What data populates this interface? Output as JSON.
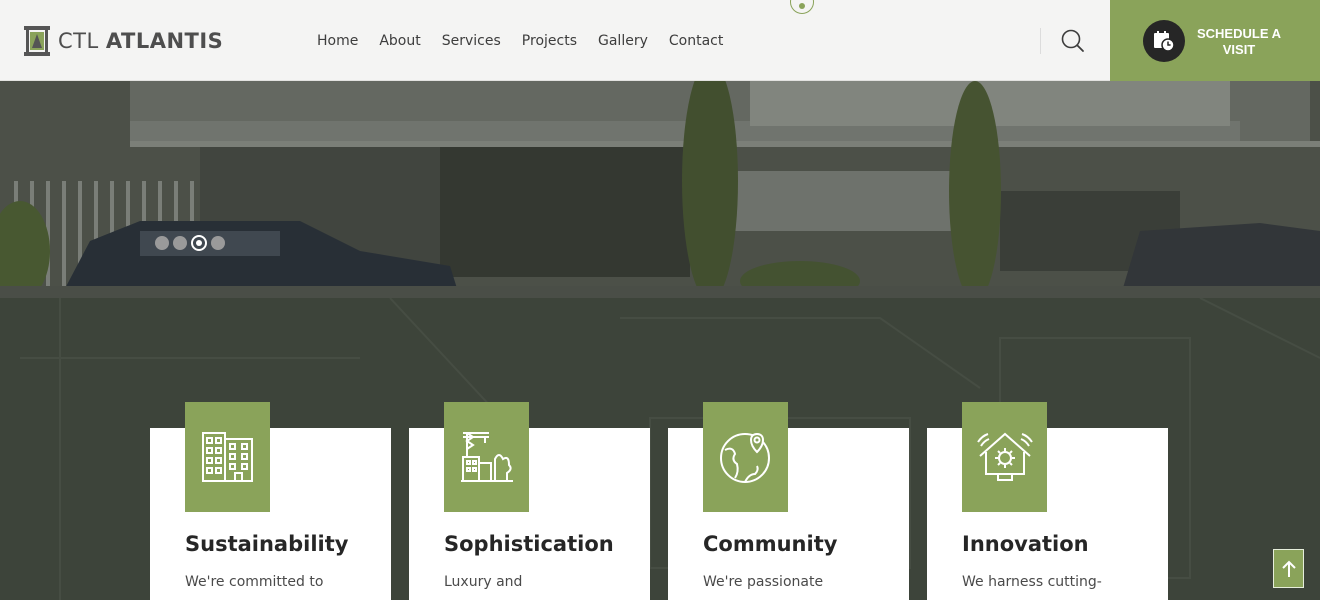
{
  "header": {
    "logo": {
      "light": "CTL ",
      "bold": "ATLANTIS"
    },
    "nav": [
      {
        "label": "Home",
        "active": true
      },
      {
        "label": "About"
      },
      {
        "label": "Services"
      },
      {
        "label": "Projects"
      },
      {
        "label": "Gallery"
      },
      {
        "label": "Contact"
      }
    ],
    "search_icon": "search-icon",
    "schedule": {
      "label": "SCHEDULE A VISIT",
      "icon": "calendar-clock-icon"
    }
  },
  "hero": {
    "slides_count": 4,
    "active_slide_index": 2
  },
  "features": [
    {
      "title": "Sustainability",
      "text": "We're committed to",
      "icon": "apartment-building-icon"
    },
    {
      "title": "Sophistication",
      "text": "Luxury and",
      "icon": "construction-crane-icon"
    },
    {
      "title": "Community",
      "text": "We're passionate",
      "icon": "globe-location-icon"
    },
    {
      "title": "Innovation",
      "text": "We harness cutting-",
      "icon": "smart-home-icon"
    }
  ],
  "back_to_top": {
    "icon": "arrow-up-icon"
  },
  "colors": {
    "accent": "#8aa35a",
    "header_bg": "#f4f4f3",
    "dark_section": "#3a4137",
    "dark_circle": "#262626"
  }
}
